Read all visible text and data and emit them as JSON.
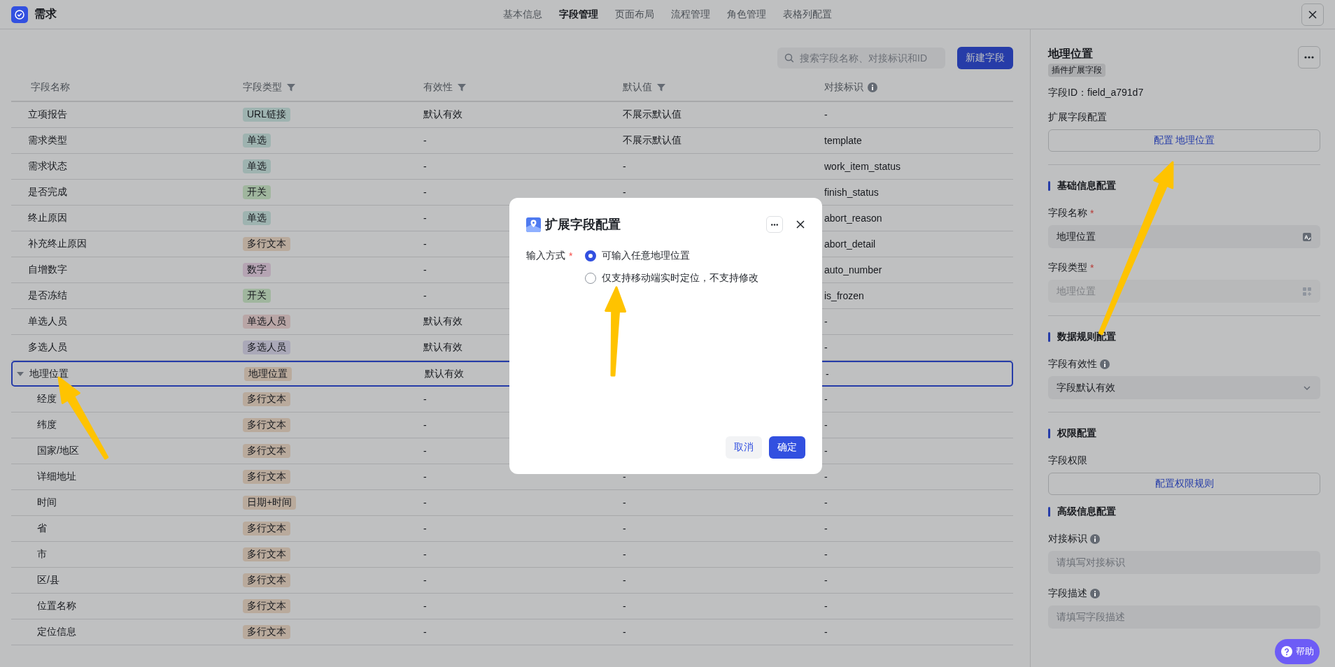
{
  "app": {
    "title": "需求"
  },
  "nav_tabs": [
    {
      "label": "基本信息",
      "selected": false
    },
    {
      "label": "字段管理",
      "selected": true
    },
    {
      "label": "页面布局",
      "selected": false
    },
    {
      "label": "流程管理",
      "selected": false
    },
    {
      "label": "角色管理",
      "selected": false
    },
    {
      "label": "表格列配置",
      "selected": false
    }
  ],
  "toolbar": {
    "search": {
      "placeholder": "搜索字段名称、对接标识和ID"
    },
    "new_button": "新建字段"
  },
  "table": {
    "columns": [
      {
        "label": "字段名称",
        "filter": false,
        "info": false
      },
      {
        "label": "字段类型",
        "filter": true,
        "info": false
      },
      {
        "label": "有效性",
        "filter": true,
        "info": false
      },
      {
        "label": "默认值",
        "filter": true,
        "info": false
      },
      {
        "label": "对接标识",
        "filter": false,
        "info": true
      }
    ],
    "rows": [
      {
        "name": "立项报告",
        "type": {
          "label": "URL链接",
          "color": "#9eb3b0"
        },
        "validity": "默认有效",
        "default": "不展示默认值",
        "key": "-",
        "selected": false
      },
      {
        "name": "需求类型",
        "type": {
          "label": "单选",
          "color": "#9eb3b0"
        },
        "validity": "-",
        "default": "不展示默认值",
        "key": "template",
        "selected": false
      },
      {
        "name": "需求状态",
        "type": {
          "label": "单选",
          "color": "#9eb3b0"
        },
        "validity": "-",
        "default": "-",
        "key": "work_item_status",
        "selected": false
      },
      {
        "name": "是否完成",
        "type": {
          "label": "开关",
          "color": "#a0b69e"
        },
        "validity": "-",
        "default": "-",
        "key": "finish_status",
        "selected": false
      },
      {
        "name": "终止原因",
        "type": {
          "label": "单选",
          "color": "#9eb3b0"
        },
        "validity": "-",
        "key": "abort_reason",
        "selected": false
      },
      {
        "name": "补充终止原因",
        "type": {
          "label": "多行文本",
          "color": "#b9aa9c"
        },
        "validity": "-",
        "key": "abort_detail",
        "selected": false
      },
      {
        "name": "自增数字",
        "type": {
          "label": "数字",
          "color": "#b5a4b3"
        },
        "validity": "-",
        "key": "auto_number",
        "selected": false
      },
      {
        "name": "是否冻结",
        "type": {
          "label": "开关",
          "color": "#a0b69e"
        },
        "validity": "-",
        "key": "is_frozen",
        "selected": false
      },
      {
        "name": "单选人员",
        "type": {
          "label": "单选人员",
          "color": "#b9a6a6"
        },
        "validity": "默认有效",
        "key": "-",
        "selected": false
      },
      {
        "name": "多选人员",
        "type": {
          "label": "多选人员",
          "color": "#aaa8b8"
        },
        "validity": "默认有效",
        "key": "-",
        "selected": false
      },
      {
        "name": "地理位置",
        "type": {
          "label": "地理位置",
          "color": "#b9aa9c"
        },
        "validity": "默认有效",
        "key": "-",
        "selected": true,
        "expanded": true,
        "children": [
          {
            "name": "经度",
            "type": {
              "label": "多行文本",
              "color": "#b9aa9c"
            },
            "validity": "-",
            "key": "-",
            "selected": false
          },
          {
            "name": "纬度",
            "type": {
              "label": "多行文本",
              "color": "#b9aa9c"
            },
            "validity": "-",
            "key": "-",
            "selected": false
          },
          {
            "name": "国家/地区",
            "type": {
              "label": "多行文本",
              "color": "#b9aa9c"
            },
            "validity": "-",
            "key": "-",
            "selected": false
          },
          {
            "name": "详细地址",
            "type": {
              "label": "多行文本",
              "color": "#b9aa9c"
            },
            "validity": "-",
            "default": "-",
            "key": "-",
            "selected": false
          },
          {
            "name": "时间",
            "type": {
              "label": "日期+时间",
              "color": "#b9aa9c"
            },
            "validity": "-",
            "default": "-",
            "key": "-",
            "selected": false
          },
          {
            "name": "省",
            "type": {
              "label": "多行文本",
              "color": "#b9aa9c"
            },
            "validity": "-",
            "default": "-",
            "key": "-",
            "selected": false
          },
          {
            "name": "市",
            "type": {
              "label": "多行文本",
              "color": "#b9aa9c"
            },
            "validity": "-",
            "default": "-",
            "key": "-",
            "selected": false
          },
          {
            "name": "区/县",
            "type": {
              "label": "多行文本",
              "color": "#b9aa9c"
            },
            "validity": "-",
            "default": "-",
            "key": "-",
            "selected": false
          },
          {
            "name": "位置名称",
            "type": {
              "label": "多行文本",
              "color": "#b9aa9c"
            },
            "validity": "-",
            "default": "-",
            "key": "-",
            "selected": false
          },
          {
            "name": "定位信息",
            "type": {
              "label": "多行文本",
              "color": "#b9aa9c"
            },
            "validity": "-",
            "default": "-",
            "key": "-",
            "selected": false
          }
        ]
      }
    ]
  },
  "side_panel": {
    "title": "地理位置",
    "tag": "插件扩展字段",
    "field_id": "字段ID：field_a791d7",
    "sections": [
      {
        "divider": true,
        "items": [
          {
            "kind": "button",
            "label": "扩展字段配置",
            "button": "配置 地理位置"
          }
        ]
      },
      {
        "title": "基础信息配置",
        "divider": true,
        "items": [
          {
            "kind": "name_input",
            "label": "字段名称",
            "required_mark": "*",
            "value": "地理位置"
          },
          {
            "kind": "type_picker",
            "label": "字段类型",
            "required_mark": "*",
            "value": "地理位置",
            "disabled": true
          }
        ]
      },
      {
        "title": "数据规则配置",
        "divider": true,
        "items": [
          {
            "kind": "select",
            "label": "字段有效性",
            "info": true,
            "value": "字段默认有效"
          }
        ]
      },
      {
        "title": "权限配置",
        "divider": false,
        "items": [
          {
            "kind": "button",
            "label": "字段权限",
            "button": "配置权限规则"
          }
        ]
      },
      {
        "title": "高级信息配置",
        "divider": false,
        "items": [
          {
            "kind": "input",
            "label": "对接标识",
            "info": true,
            "placeholder": "请填写对接标识"
          },
          {
            "kind": "input",
            "label": "字段描述",
            "info": true,
            "placeholder": "请填写字段描述"
          }
        ]
      }
    ]
  },
  "dialog": {
    "title": "扩展字段配置",
    "field_label": "输入方式",
    "required_mark": "*",
    "options": [
      {
        "label": "可输入任意地理位置",
        "selected": true
      },
      {
        "label": "仅支持移动端实时定位，不支持修改",
        "selected": false
      }
    ],
    "buttons": [
      {
        "label": "取消",
        "kind": "secondary"
      },
      {
        "label": "确定",
        "kind": "primary"
      }
    ]
  },
  "help_button": "帮助",
  "annotations": [
    {
      "kind": "arrow"
    },
    {
      "kind": "arrow"
    },
    {
      "kind": "arrow"
    }
  ]
}
